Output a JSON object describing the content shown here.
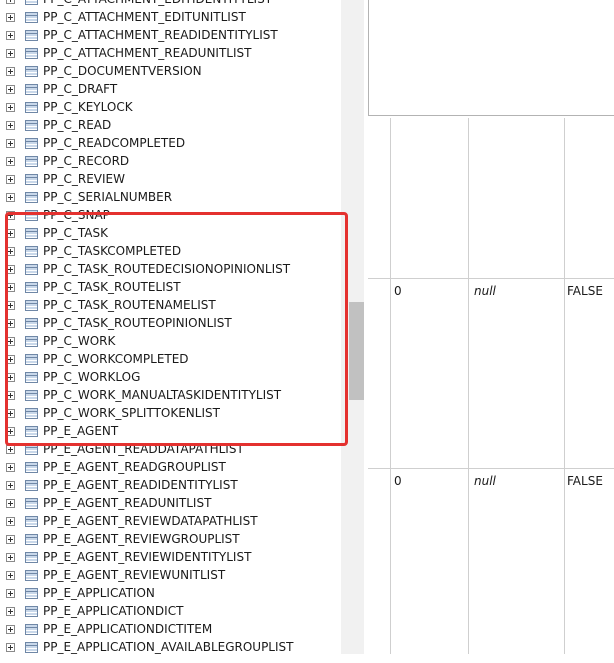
{
  "tree": {
    "items": [
      "PP_C_ATTACHMENT_EDITIDENTITYLIST",
      "PP_C_ATTACHMENT_EDITUNITLIST",
      "PP_C_ATTACHMENT_READIDENTITYLIST",
      "PP_C_ATTACHMENT_READUNITLIST",
      "PP_C_DOCUMENTVERSION",
      "PP_C_DRAFT",
      "PP_C_KEYLOCK",
      "PP_C_READ",
      "PP_C_READCOMPLETED",
      "PP_C_RECORD",
      "PP_C_REVIEW",
      "PP_C_SERIALNUMBER",
      "PP_C_SNAP",
      "PP_C_TASK",
      "PP_C_TASKCOMPLETED",
      "PP_C_TASK_ROUTEDECISIONOPINIONLIST",
      "PP_C_TASK_ROUTELIST",
      "PP_C_TASK_ROUTENAMELIST",
      "PP_C_TASK_ROUTEOPINIONLIST",
      "PP_C_WORK",
      "PP_C_WORKCOMPLETED",
      "PP_C_WORKLOG",
      "PP_C_WORK_MANUALTASKIDENTITYLIST",
      "PP_C_WORK_SPLITTOKENLIST",
      "PP_E_AGENT",
      "PP_E_AGENT_READDATAPATHLIST",
      "PP_E_AGENT_READGROUPLIST",
      "PP_E_AGENT_READIDENTITYLIST",
      "PP_E_AGENT_READUNITLIST",
      "PP_E_AGENT_REVIEWDATAPATHLIST",
      "PP_E_AGENT_REVIEWGROUPLIST",
      "PP_E_AGENT_REVIEWIDENTITYLIST",
      "PP_E_AGENT_REVIEWUNITLIST",
      "PP_E_APPLICATION",
      "PP_E_APPLICATIONDICT",
      "PP_E_APPLICATIONDICTITEM",
      "PP_E_APPLICATION_AVAILABLEGROUPLIST"
    ]
  },
  "grid": {
    "rows": [
      {
        "value": "0",
        "default": "null",
        "flag": "FALSE"
      },
      {
        "value": "0",
        "default": "null",
        "flag": "FALSE"
      }
    ]
  },
  "colors": {
    "highlight": "#e4312f",
    "scrollbar_thumb": "#c1c1c1",
    "grid_line": "#cfcfcf"
  }
}
